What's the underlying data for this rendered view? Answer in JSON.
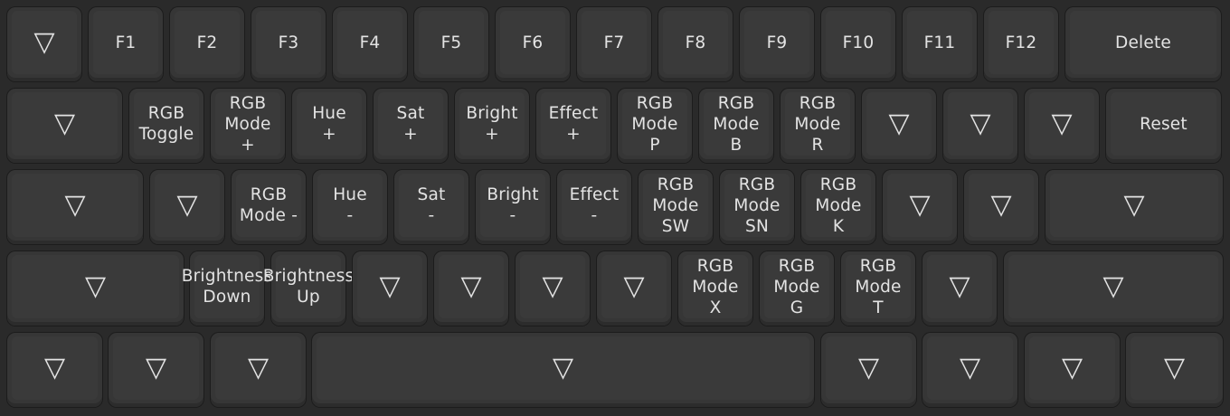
{
  "keyboard": {
    "rows": [
      [
        "▽",
        "F1",
        "F2",
        "F3",
        "F4",
        "F5",
        "F6",
        "F7",
        "F8",
        "F9",
        "F10",
        "F11",
        "F12",
        "Delete"
      ],
      [
        "▽",
        "RGB\nToggle",
        "RGB\nMode\n+",
        "Hue\n+",
        "Sat\n+",
        "Bright\n+",
        "Effect\n+",
        "RGB\nMode\nP",
        "RGB\nMode\nB",
        "RGB\nMode\nR",
        "▽",
        "▽",
        "▽",
        "Reset"
      ],
      [
        "▽",
        "▽",
        "RGB\nMode -",
        "Hue\n-",
        "Sat\n-",
        "Bright\n-",
        "Effect\n-",
        "RGB\nMode\nSW",
        "RGB\nMode\nSN",
        "RGB\nMode\nK",
        "▽",
        "▽",
        "▽"
      ],
      [
        "▽",
        "Brightness\nDown",
        "Brightness\nUp",
        "▽",
        "▽",
        "▽",
        "▽",
        "RGB\nMode\nX",
        "RGB\nMode\nG",
        "RGB\nMode\nT",
        "▽",
        "▽"
      ],
      [
        "▽",
        "▽",
        "▽",
        "▽",
        "▽",
        "▽",
        "▽",
        "▽"
      ]
    ]
  }
}
